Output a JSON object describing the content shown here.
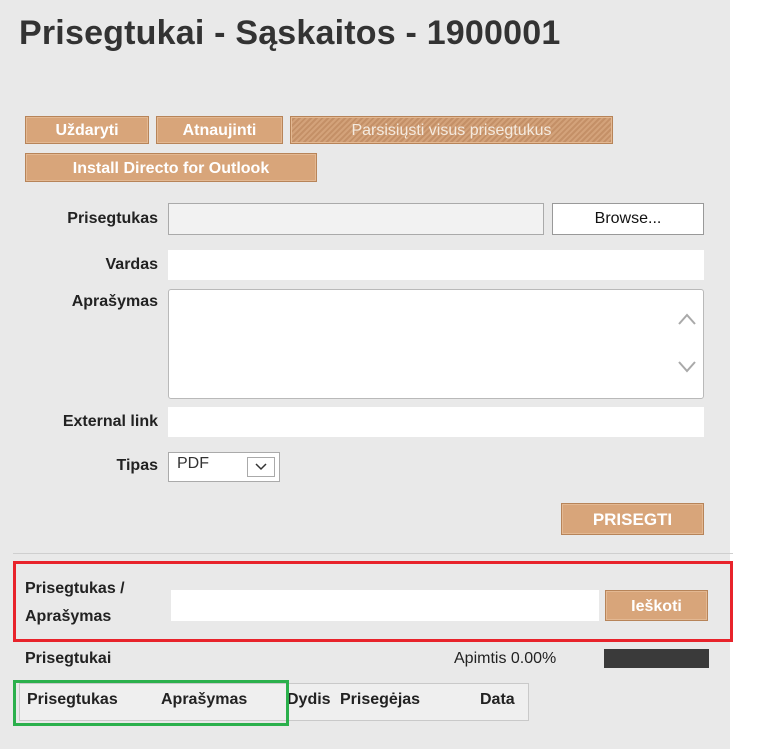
{
  "window": {
    "title": "Prisegtukai - Sąskaitos - 1900001"
  },
  "toolbar": {
    "close_label": "Uždaryti",
    "refresh_label": "Atnaujinti",
    "download_all_label": "Parsisiųsti visus prisegtukus",
    "install_outlook_label": "Install Directo for Outlook"
  },
  "form": {
    "attachment_label": "Prisegtukas",
    "browse_label": "Browse...",
    "name_label": "Vardas",
    "description_label": "Aprašymas",
    "external_link_label": "External link",
    "type_label": "Tipas",
    "type_value": "PDF",
    "attach_button": "PRISEGTI"
  },
  "search": {
    "label_line1": "Prisegtukas /",
    "label_line2": "Aprašymas",
    "value": "",
    "button": "Ieškoti"
  },
  "list": {
    "heading": "Prisegtukai",
    "usage_label": "Apimtis 0.00%",
    "usage_fraction": 0.0,
    "columns": [
      "Prisegtukas",
      "Aprašymas",
      "Dydis",
      "Prisegėjas",
      "Data"
    ]
  },
  "colors": {
    "button_bg": "#d8a57a",
    "highlight_red": "#e8232b",
    "highlight_green": "#2bb04c",
    "panel_bg": "#e9e9e9"
  }
}
